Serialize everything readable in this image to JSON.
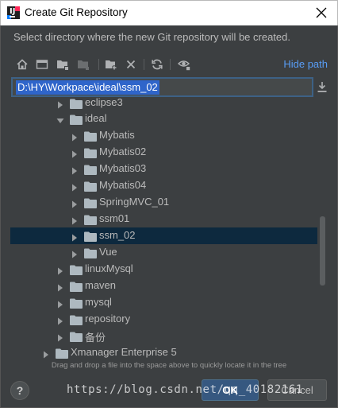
{
  "window": {
    "title": "Create Git Repository",
    "description": "Select directory where the new Git repository will be created."
  },
  "toolbar": {
    "buttons": [
      "home-icon",
      "desktop-icon",
      "project-folder-icon",
      "module-folder-icon",
      "new-folder-icon",
      "delete-icon",
      "refresh-icon",
      "show-hidden-icon"
    ],
    "hide_path_label": "Hide path"
  },
  "path": {
    "value": "D:\\HY\\Workpace\\ideal\\ssm_02"
  },
  "tree": {
    "rows": [
      {
        "label": "eclipse3",
        "arrow": "right"
      },
      {
        "label": "ideal",
        "arrow": "down"
      },
      {
        "label": "Mybatis",
        "arrow": "right"
      },
      {
        "label": "Mybatis02",
        "arrow": "right"
      },
      {
        "label": "Mybatis03",
        "arrow": "right"
      },
      {
        "label": "Mybatis04",
        "arrow": "right"
      },
      {
        "label": "SpringMVC_01",
        "arrow": "right"
      },
      {
        "label": "ssm01",
        "arrow": "right"
      },
      {
        "label": "ssm_02",
        "arrow": "right",
        "selected": true
      },
      {
        "label": "Vue",
        "arrow": "right"
      },
      {
        "label": "linuxMysql",
        "arrow": "right"
      },
      {
        "label": "maven",
        "arrow": "right"
      },
      {
        "label": "mysql",
        "arrow": "right"
      },
      {
        "label": "repository",
        "arrow": "right"
      },
      {
        "label": "备份",
        "arrow": "right"
      },
      {
        "label": "Xmanager Enterprise 5",
        "arrow": "right"
      }
    ]
  },
  "hint": "Drag and drop a file into the space above to quickly locate it in the tree",
  "footer": {
    "help_label": "?",
    "ok_label": "OK",
    "cancel_label": "Cancel",
    "watermark": "https://blog.csdn.net/qq_40182161"
  },
  "colors": {
    "background": "#3c3f41",
    "accent_link": "#589df6",
    "selection": "#0d293e",
    "ok_button": "#365880",
    "folder": "#aeb9c0"
  }
}
